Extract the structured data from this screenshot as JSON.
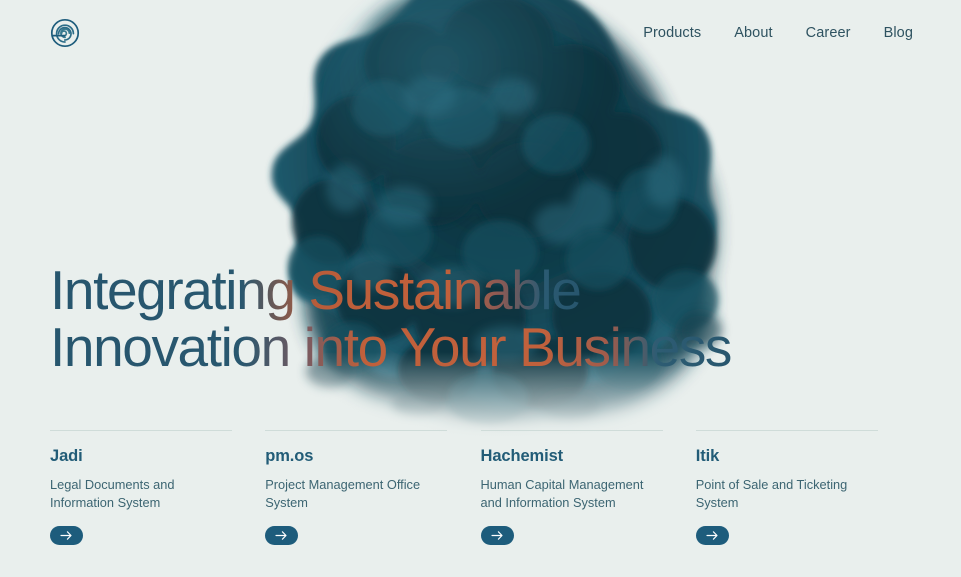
{
  "theme": {
    "page_background": "#e9efed",
    "ink_dark": "#0d2f38",
    "ink_mid": "#184a5c",
    "ink_light": "#2d6a7d",
    "accent_orange": "#c0603b",
    "accent_blue": "#27566e",
    "title_color": "#225c77",
    "body_color": "#3c6572",
    "nav_color": "#2e5260",
    "rule_color": "#cfdcd9",
    "button_color": "#1d5c7c"
  },
  "header": {
    "logo_icon": "spiral-logo-icon",
    "nav": [
      {
        "label": "Products"
      },
      {
        "label": "About"
      },
      {
        "label": "Career"
      },
      {
        "label": "Blog"
      }
    ]
  },
  "hero": {
    "headline_line_1": "Integrating Sustainable",
    "headline_line_2": "Innovation into Your Business",
    "background_image": "dark-teal-ink-cloud"
  },
  "products": [
    {
      "title": "Jadi",
      "description": "Legal Documents and Information System",
      "cta_icon": "arrow-right-icon"
    },
    {
      "title": "pm.os",
      "description": "Project Management Office System",
      "cta_icon": "arrow-right-icon"
    },
    {
      "title": "Hachemist",
      "description": "Human Capital Management and Information System",
      "cta_icon": "arrow-right-icon"
    },
    {
      "title": "Itik",
      "description": "Point of Sale and Ticketing System",
      "cta_icon": "arrow-right-icon"
    }
  ]
}
